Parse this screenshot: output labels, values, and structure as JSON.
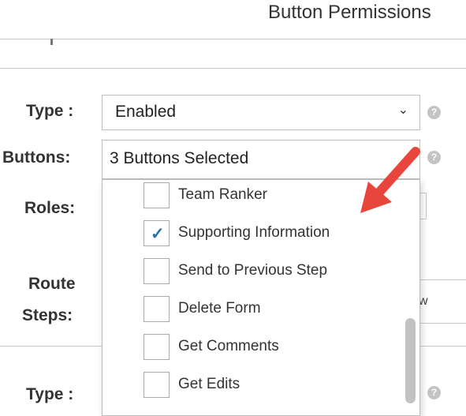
{
  "header": {
    "title": "Button Permissions"
  },
  "form": {
    "type_label": "Type :",
    "type_value": "Enabled",
    "buttons_label": "Buttons:",
    "buttons_value": "3 Buttons Selected",
    "roles_label": "Roles:",
    "route_label_1": "Route",
    "route_label_2": "Steps:",
    "type2_label": "Type :",
    "help_glyph": "?",
    "chevron_glyph": "⌄",
    "partial_text": "w"
  },
  "dropdown": {
    "options": [
      {
        "label": "Team Ranker",
        "checked": false
      },
      {
        "label": "Supporting Information",
        "checked": true
      },
      {
        "label": "Send to Previous Step",
        "checked": false
      },
      {
        "label": "Delete Form",
        "checked": false
      },
      {
        "label": "Get Comments",
        "checked": false
      },
      {
        "label": "Get Edits",
        "checked": false
      }
    ],
    "check_glyph": "✓"
  },
  "annotation": {
    "arrow_color": "#e8463c"
  }
}
